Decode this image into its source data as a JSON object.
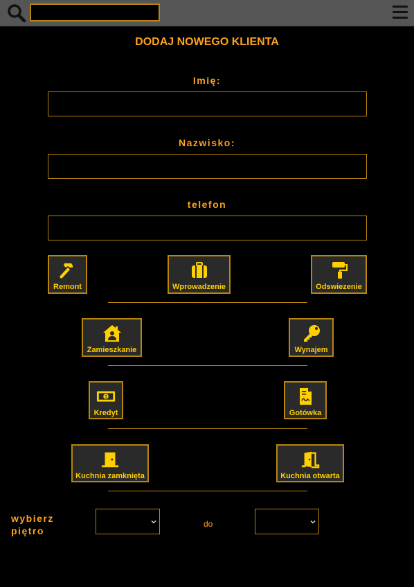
{
  "topbar": {
    "search_icon": "search-icon",
    "search_value": "",
    "menu_icon": "hamburger-menu-icon"
  },
  "form": {
    "title": "DODAJ NOWEGO KLIENTA",
    "first_name_label": "Imię:",
    "first_name_value": "",
    "last_name_label": "Nazwisko:",
    "last_name_value": "",
    "phone_label": "telefon",
    "phone_value": ""
  },
  "options": {
    "remont": {
      "label": "Remont",
      "icon": "hammer-icon"
    },
    "wprowadzenie": {
      "label": "Wprowadzenie",
      "icon": "suitcase-icon"
    },
    "odswiezenie": {
      "label": "Odswiezenie",
      "icon": "paint-roller-icon"
    },
    "zamieszkanie": {
      "label": "Zamieszkanie",
      "icon": "house-user-icon"
    },
    "wynajem": {
      "label": "Wynajem",
      "icon": "key-icon"
    },
    "kredyt": {
      "label": "Kredyt",
      "icon": "money-bill-icon"
    },
    "gotowka": {
      "label": "Gotówka",
      "icon": "file-invoice-icon"
    },
    "kuchnia_zamknieta": {
      "label": "Kuchnia zamknięta",
      "icon": "door-closed-icon"
    },
    "kuchnia_otwarta": {
      "label": "Kuchnia otwarta",
      "icon": "door-open-icon"
    }
  },
  "floor": {
    "label": "wybierz piętro",
    "from_value": "",
    "to_label": "do",
    "to_value": ""
  },
  "colors": {
    "accent": "#ffa31a",
    "icon_yellow": "#ffd000",
    "border_gold": "#b8860b",
    "topbar_bg": "#555555",
    "button_bg": "#2a2a2a",
    "page_bg": "#000000"
  }
}
